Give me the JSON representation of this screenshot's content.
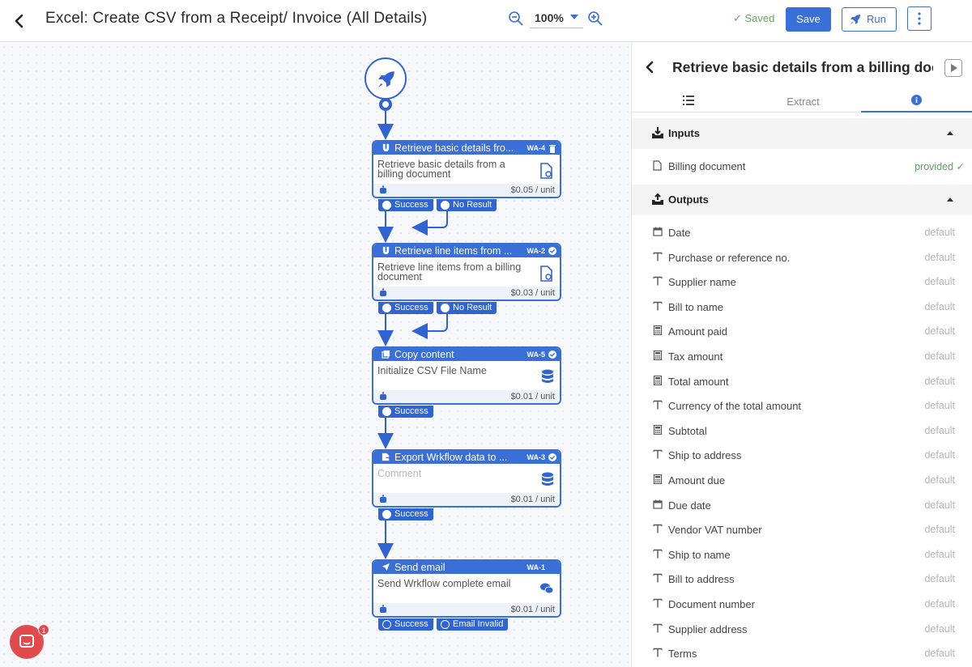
{
  "header": {
    "title": "Excel: Create CSV from a Receipt/ Invoice (All Details)",
    "zoom": "100%",
    "saved_label": "Saved",
    "save_label": "Save",
    "run_label": "Run"
  },
  "nodes": [
    {
      "title": "Retrieve basic details fro...",
      "code": "WA-4",
      "body": "Retrieve basic details from a billing document",
      "cost": "$0.05 / unit",
      "ports": [
        "Success",
        "No Result"
      ]
    },
    {
      "title": "Retrieve line items from ...",
      "code": "WA-2",
      "body": "Retrieve line items from a billing document",
      "cost": "$0.03 / unit",
      "ports": [
        "Success",
        "No Result"
      ]
    },
    {
      "title": "Copy content",
      "code": "WA-5",
      "body": "Initialize CSV File Name",
      "cost": "$0.01 / unit",
      "ports": [
        "Success"
      ]
    },
    {
      "title": "Export Wrkflow data to ...",
      "code": "WA-3",
      "body": "Comment",
      "cost": "$0.01 / unit",
      "ports": [
        "Success"
      ]
    },
    {
      "title": "Send email",
      "code": "WA-1",
      "body": "Send Wrkflow complete email",
      "cost": "$0.01 / unit",
      "ports": [
        "Success",
        "Email Invalid"
      ]
    }
  ],
  "chat": {
    "badge": "1"
  },
  "panel": {
    "title": "Retrieve basic details from a billing document",
    "tabs": {
      "extract": "Extract"
    },
    "inputs_label": "Inputs",
    "outputs_label": "Outputs",
    "inputs": [
      {
        "label": "Billing document",
        "status": "provided ✓"
      }
    ],
    "outputs": [
      {
        "label": "Date",
        "status": "default",
        "icon": "calendar-icon"
      },
      {
        "label": "Purchase or reference no.",
        "status": "default",
        "icon": "text-icon"
      },
      {
        "label": "Supplier name",
        "status": "default",
        "icon": "text-icon"
      },
      {
        "label": "Bill to name",
        "status": "default",
        "icon": "text-icon"
      },
      {
        "label": "Amount paid",
        "status": "default",
        "icon": "calculator-icon"
      },
      {
        "label": "Tax amount",
        "status": "default",
        "icon": "calculator-icon"
      },
      {
        "label": "Total amount",
        "status": "default",
        "icon": "calculator-icon"
      },
      {
        "label": "Currency of the total amount",
        "status": "default",
        "icon": "text-icon"
      },
      {
        "label": "Subtotal",
        "status": "default",
        "icon": "calculator-icon"
      },
      {
        "label": "Ship to address",
        "status": "default",
        "icon": "text-icon"
      },
      {
        "label": "Amount due",
        "status": "default",
        "icon": "calculator-icon"
      },
      {
        "label": "Due date",
        "status": "default",
        "icon": "calendar-icon"
      },
      {
        "label": "Vendor VAT number",
        "status": "default",
        "icon": "text-icon"
      },
      {
        "label": "Ship to name",
        "status": "default",
        "icon": "text-icon"
      },
      {
        "label": "Bill to address",
        "status": "default",
        "icon": "text-icon"
      },
      {
        "label": "Document number",
        "status": "default",
        "icon": "text-icon"
      },
      {
        "label": "Supplier address",
        "status": "default",
        "icon": "text-icon"
      },
      {
        "label": "Terms",
        "status": "default",
        "icon": "text-icon"
      }
    ]
  }
}
